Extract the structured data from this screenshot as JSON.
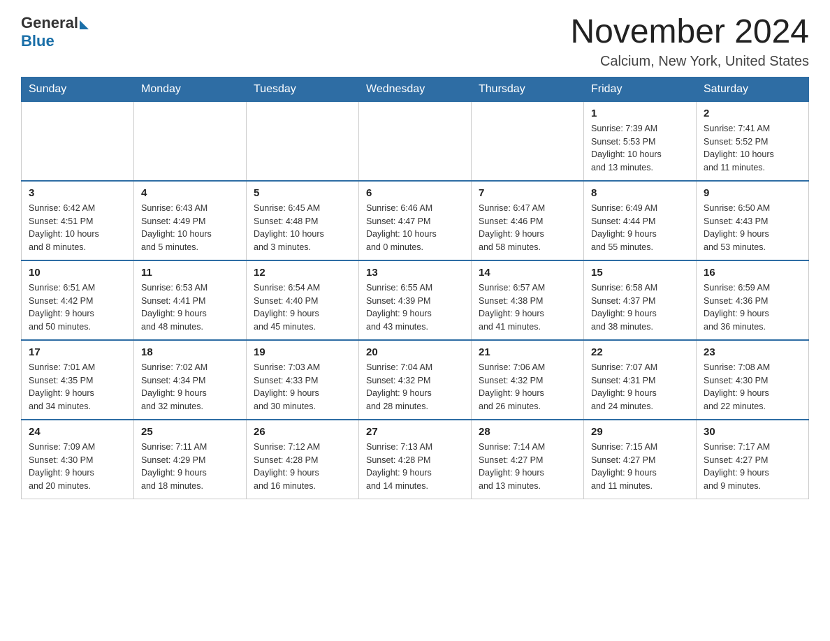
{
  "header": {
    "logo_general": "General",
    "logo_blue": "Blue",
    "month_title": "November 2024",
    "location": "Calcium, New York, United States"
  },
  "days_of_week": [
    "Sunday",
    "Monday",
    "Tuesday",
    "Wednesday",
    "Thursday",
    "Friday",
    "Saturday"
  ],
  "weeks": [
    [
      {
        "day": "",
        "info": ""
      },
      {
        "day": "",
        "info": ""
      },
      {
        "day": "",
        "info": ""
      },
      {
        "day": "",
        "info": ""
      },
      {
        "day": "",
        "info": ""
      },
      {
        "day": "1",
        "info": "Sunrise: 7:39 AM\nSunset: 5:53 PM\nDaylight: 10 hours\nand 13 minutes."
      },
      {
        "day": "2",
        "info": "Sunrise: 7:41 AM\nSunset: 5:52 PM\nDaylight: 10 hours\nand 11 minutes."
      }
    ],
    [
      {
        "day": "3",
        "info": "Sunrise: 6:42 AM\nSunset: 4:51 PM\nDaylight: 10 hours\nand 8 minutes."
      },
      {
        "day": "4",
        "info": "Sunrise: 6:43 AM\nSunset: 4:49 PM\nDaylight: 10 hours\nand 5 minutes."
      },
      {
        "day": "5",
        "info": "Sunrise: 6:45 AM\nSunset: 4:48 PM\nDaylight: 10 hours\nand 3 minutes."
      },
      {
        "day": "6",
        "info": "Sunrise: 6:46 AM\nSunset: 4:47 PM\nDaylight: 10 hours\nand 0 minutes."
      },
      {
        "day": "7",
        "info": "Sunrise: 6:47 AM\nSunset: 4:46 PM\nDaylight: 9 hours\nand 58 minutes."
      },
      {
        "day": "8",
        "info": "Sunrise: 6:49 AM\nSunset: 4:44 PM\nDaylight: 9 hours\nand 55 minutes."
      },
      {
        "day": "9",
        "info": "Sunrise: 6:50 AM\nSunset: 4:43 PM\nDaylight: 9 hours\nand 53 minutes."
      }
    ],
    [
      {
        "day": "10",
        "info": "Sunrise: 6:51 AM\nSunset: 4:42 PM\nDaylight: 9 hours\nand 50 minutes."
      },
      {
        "day": "11",
        "info": "Sunrise: 6:53 AM\nSunset: 4:41 PM\nDaylight: 9 hours\nand 48 minutes."
      },
      {
        "day": "12",
        "info": "Sunrise: 6:54 AM\nSunset: 4:40 PM\nDaylight: 9 hours\nand 45 minutes."
      },
      {
        "day": "13",
        "info": "Sunrise: 6:55 AM\nSunset: 4:39 PM\nDaylight: 9 hours\nand 43 minutes."
      },
      {
        "day": "14",
        "info": "Sunrise: 6:57 AM\nSunset: 4:38 PM\nDaylight: 9 hours\nand 41 minutes."
      },
      {
        "day": "15",
        "info": "Sunrise: 6:58 AM\nSunset: 4:37 PM\nDaylight: 9 hours\nand 38 minutes."
      },
      {
        "day": "16",
        "info": "Sunrise: 6:59 AM\nSunset: 4:36 PM\nDaylight: 9 hours\nand 36 minutes."
      }
    ],
    [
      {
        "day": "17",
        "info": "Sunrise: 7:01 AM\nSunset: 4:35 PM\nDaylight: 9 hours\nand 34 minutes."
      },
      {
        "day": "18",
        "info": "Sunrise: 7:02 AM\nSunset: 4:34 PM\nDaylight: 9 hours\nand 32 minutes."
      },
      {
        "day": "19",
        "info": "Sunrise: 7:03 AM\nSunset: 4:33 PM\nDaylight: 9 hours\nand 30 minutes."
      },
      {
        "day": "20",
        "info": "Sunrise: 7:04 AM\nSunset: 4:32 PM\nDaylight: 9 hours\nand 28 minutes."
      },
      {
        "day": "21",
        "info": "Sunrise: 7:06 AM\nSunset: 4:32 PM\nDaylight: 9 hours\nand 26 minutes."
      },
      {
        "day": "22",
        "info": "Sunrise: 7:07 AM\nSunset: 4:31 PM\nDaylight: 9 hours\nand 24 minutes."
      },
      {
        "day": "23",
        "info": "Sunrise: 7:08 AM\nSunset: 4:30 PM\nDaylight: 9 hours\nand 22 minutes."
      }
    ],
    [
      {
        "day": "24",
        "info": "Sunrise: 7:09 AM\nSunset: 4:30 PM\nDaylight: 9 hours\nand 20 minutes."
      },
      {
        "day": "25",
        "info": "Sunrise: 7:11 AM\nSunset: 4:29 PM\nDaylight: 9 hours\nand 18 minutes."
      },
      {
        "day": "26",
        "info": "Sunrise: 7:12 AM\nSunset: 4:28 PM\nDaylight: 9 hours\nand 16 minutes."
      },
      {
        "day": "27",
        "info": "Sunrise: 7:13 AM\nSunset: 4:28 PM\nDaylight: 9 hours\nand 14 minutes."
      },
      {
        "day": "28",
        "info": "Sunrise: 7:14 AM\nSunset: 4:27 PM\nDaylight: 9 hours\nand 13 minutes."
      },
      {
        "day": "29",
        "info": "Sunrise: 7:15 AM\nSunset: 4:27 PM\nDaylight: 9 hours\nand 11 minutes."
      },
      {
        "day": "30",
        "info": "Sunrise: 7:17 AM\nSunset: 4:27 PM\nDaylight: 9 hours\nand 9 minutes."
      }
    ]
  ]
}
